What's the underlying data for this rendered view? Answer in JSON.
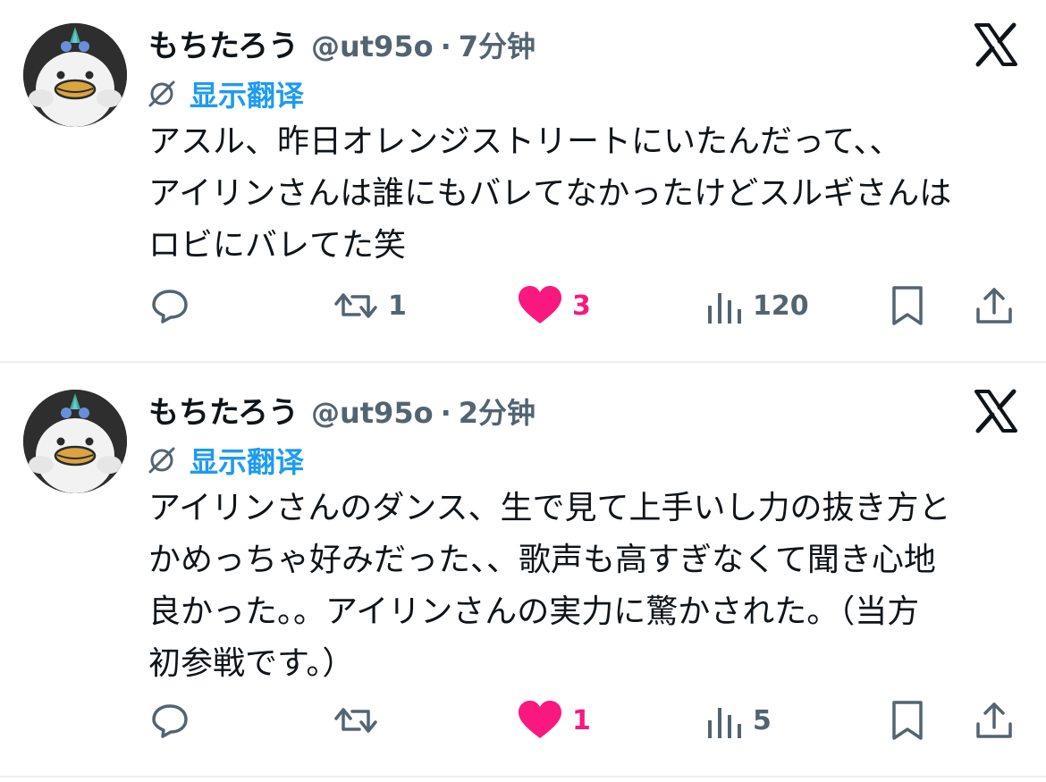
{
  "tweets": [
    {
      "author_name": "もちたろう",
      "handle": "@ut95o",
      "separator": "·",
      "time": "7分钟",
      "translate_label": "显示翻译",
      "lines": [
        "アスル、昨日オレンジストリートにいたんだって、、",
        "アイリンさんは誰にもバレてなかったけどスルギさんは",
        "ロビにバレてた笑"
      ],
      "retweets": "1",
      "likes": "3",
      "views": "120",
      "replies": ""
    },
    {
      "author_name": "もちたろう",
      "handle": "@ut95o",
      "separator": "·",
      "time": "2分钟",
      "translate_label": "显示翻译",
      "lines": [
        "アイリンさんのダンス、生で見て上手いし力の抜き方と",
        "かめっちゃ好みだった、、歌声も高すぎなくて聞き心地",
        "良かった。。アイリンさんの実力に驚かされた。（当方",
        "初参戦です。）"
      ],
      "retweets": "",
      "likes": "1",
      "views": "5",
      "replies": ""
    }
  ],
  "icons": {
    "logo": "x-logo-icon",
    "translate": "globe-slash-icon",
    "reply": "reply-bubble-icon",
    "retweet": "retweet-icon",
    "like": "heart-filled-icon",
    "views": "analytics-bars-icon",
    "bookmark": "bookmark-icon",
    "share": "share-upload-icon"
  },
  "colors": {
    "like_active": "#f91880",
    "link": "#1d9bf0",
    "secondary_text": "#536471"
  }
}
